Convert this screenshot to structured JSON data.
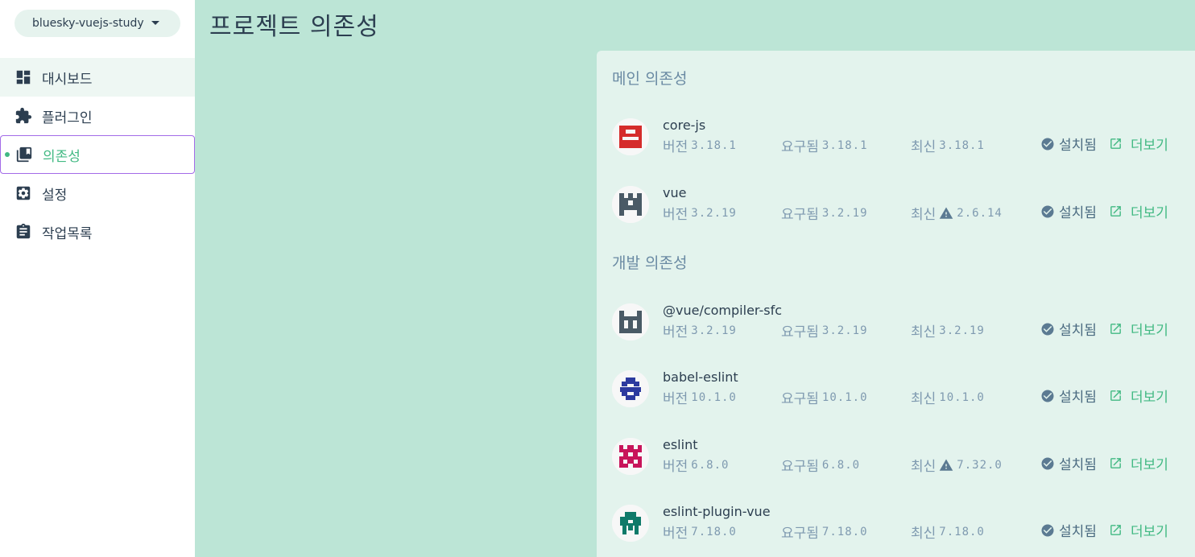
{
  "project": {
    "name": "bluesky-vuejs-study"
  },
  "nav": [
    {
      "label": "대시보드",
      "icon": "dashboard-icon"
    },
    {
      "label": "플러그인",
      "icon": "puzzle-icon"
    },
    {
      "label": "의존성",
      "icon": "library-icon"
    },
    {
      "label": "설정",
      "icon": "gear-icon"
    },
    {
      "label": "작업목록",
      "icon": "clipboard-icon"
    }
  ],
  "page_title": "프로젝트 의존성",
  "labels": {
    "version": "버전",
    "required": "요구됨",
    "latest": "최신",
    "installed": "설치됨",
    "more": "더보기"
  },
  "main_section": {
    "title": "메인 의존성",
    "deps": [
      {
        "name": "core-js",
        "version": "3.18.1",
        "required": "3.18.1",
        "latest": "3.18.1",
        "outdated": false,
        "color": "#d52b2b"
      },
      {
        "name": "vue",
        "version": "3.2.19",
        "required": "3.2.19",
        "latest": "2.6.14",
        "outdated": true,
        "color": "#4a5a66"
      }
    ]
  },
  "dev_section": {
    "title": "개발 의존성",
    "deps": [
      {
        "name": "@vue/compiler-sfc",
        "version": "3.2.19",
        "required": "3.2.19",
        "latest": "3.2.19",
        "outdated": false,
        "color": "#4a5a66"
      },
      {
        "name": "babel-eslint",
        "version": "10.1.0",
        "required": "10.1.0",
        "latest": "10.1.0",
        "outdated": false,
        "color": "#2c3a9f"
      },
      {
        "name": "eslint",
        "version": "6.8.0",
        "required": "6.8.0",
        "latest": "7.32.0",
        "outdated": true,
        "color": "#c8145a"
      },
      {
        "name": "eslint-plugin-vue",
        "version": "7.18.0",
        "required": "7.18.0",
        "latest": "7.18.0",
        "outdated": false,
        "color": "#0f7a6a"
      }
    ]
  },
  "colors": {
    "accent": "#42b983",
    "background": "#bce5d6",
    "card": "#e3f3ed",
    "selected_border": "#a36be8"
  }
}
